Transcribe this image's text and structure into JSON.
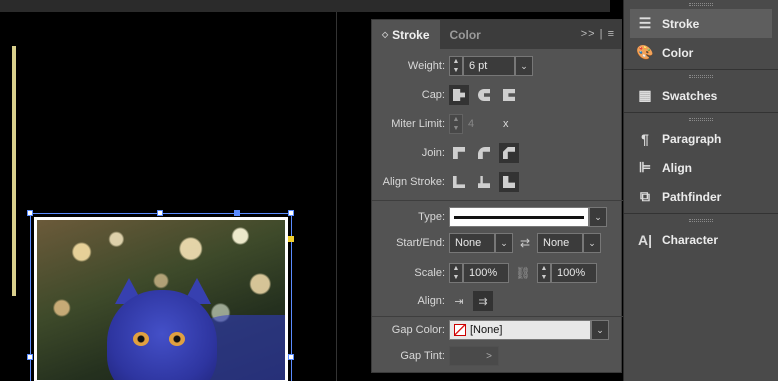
{
  "stroke_panel": {
    "tabs": [
      {
        "label": "Stroke",
        "active": true
      },
      {
        "label": "Color",
        "active": false
      }
    ],
    "menu_glyph": ">> | ≡",
    "weight_label": "Weight:",
    "weight_value": "6 pt",
    "cap_label": "Cap:",
    "miter_label": "Miter Limit:",
    "miter_value": "4",
    "miter_x": "x",
    "join_label": "Join:",
    "align_stroke_label": "Align Stroke:",
    "type_label": "Type:",
    "start_end_label": "Start/End:",
    "start_value": "None",
    "end_value": "None",
    "scale_label": "Scale:",
    "scale_start": "100%",
    "scale_end": "100%",
    "align_label": "Align:",
    "gap_color_label": "Gap Color:",
    "gap_color_value": "[None]",
    "gap_tint_label": "Gap Tint:",
    "gap_tint_value": ">"
  },
  "dock": {
    "items": [
      {
        "label": "Stroke",
        "icon": "stroke-icon"
      },
      {
        "label": "Color",
        "icon": "palette-icon"
      },
      {
        "label": "Swatches",
        "icon": "swatches-icon"
      },
      {
        "label": "Paragraph",
        "icon": "pilcrow-icon"
      },
      {
        "label": "Align",
        "icon": "align-icon"
      },
      {
        "label": "Pathfinder",
        "icon": "pathfinder-icon"
      },
      {
        "label": "Character",
        "icon": "character-icon"
      }
    ]
  },
  "colors": {
    "panel_bg": "#535353",
    "dock_bg": "#4a4a4a",
    "selection": "#5a8cff",
    "none_swatch": "#e02020"
  }
}
